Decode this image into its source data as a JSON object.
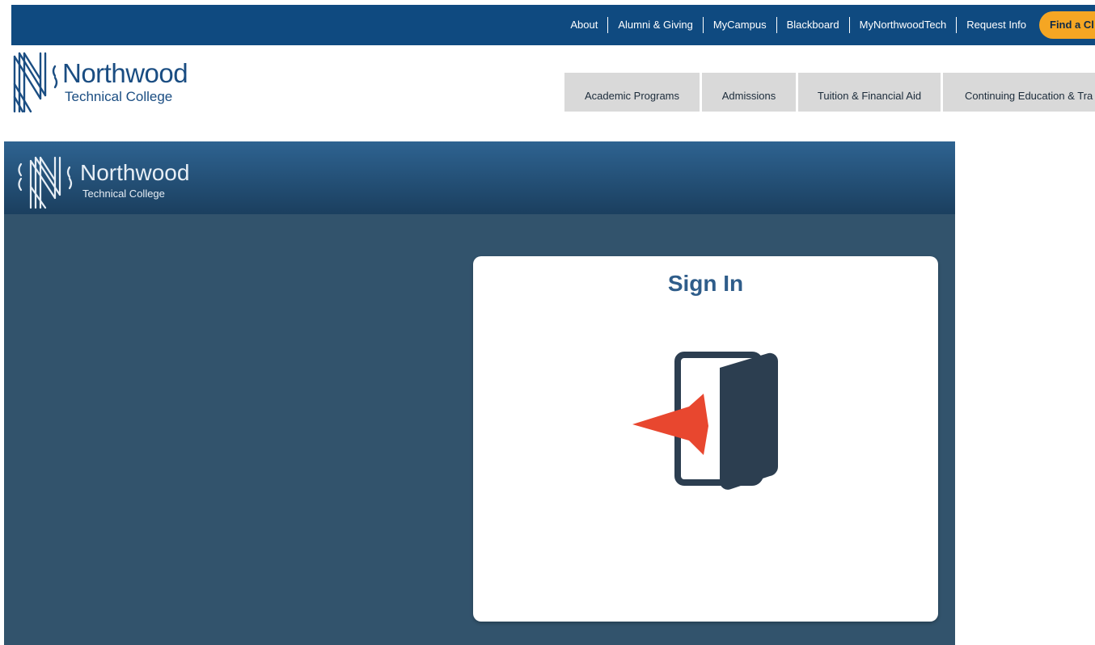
{
  "utility_bar": {
    "links": [
      "About",
      "Alumni & Giving",
      "MyCampus",
      "Blackboard",
      "MyNorthwoodTech",
      "Request Info"
    ],
    "cta_label": "Find a Cl"
  },
  "brand": {
    "name": "Northwood",
    "subtitle": "Technical College"
  },
  "main_nav": {
    "items": [
      "Academic Programs",
      "Admissions",
      "Tuition & Financial Aid",
      "Continuing Education & Tra"
    ]
  },
  "portal": {
    "brand_name": "Northwood",
    "brand_subtitle": "Technical College",
    "signin_tile": {
      "title": "Sign In",
      "icon": "sign-in-door-icon"
    }
  },
  "colors": {
    "utility_bar_bg": "#0f4a80",
    "cta_bg": "#f5a623",
    "brand_blue": "#1a4d82",
    "nav_bg": "#d9d9d9",
    "portal_bg": "#32536c",
    "signin_title": "#2f5d8a",
    "arrow_red": "#e8472f",
    "door_dark": "#2c3e50"
  }
}
